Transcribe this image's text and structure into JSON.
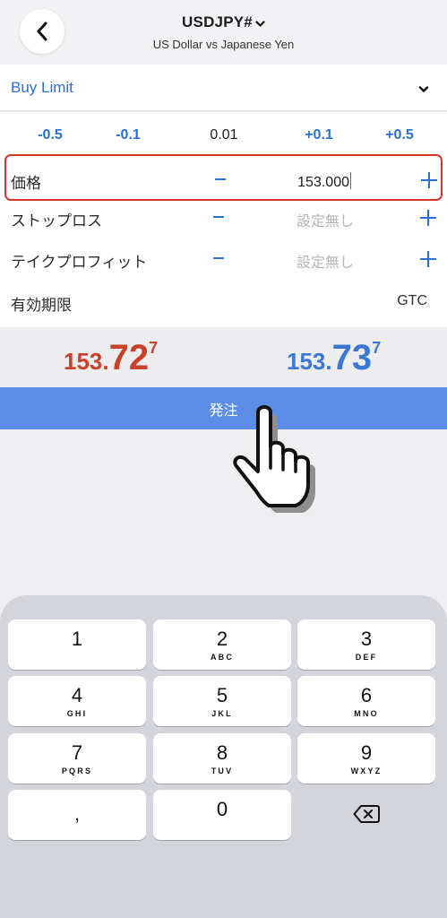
{
  "header": {
    "symbol": "USDJPY#",
    "subtitle": "US Dollar vs Japanese Yen"
  },
  "order_type": {
    "label": "Buy Limit"
  },
  "steps": [
    "-0.5",
    "-0.1",
    "0.01",
    "+0.1",
    "+0.5"
  ],
  "fields": {
    "price": {
      "label": "価格",
      "value": "153.000"
    },
    "stop_loss": {
      "label": "ストップロス",
      "value": "設定無し"
    },
    "take_profit": {
      "label": "テイクプロフィット",
      "value": "設定無し"
    },
    "expiry": {
      "label": "有効期限",
      "value": "GTC"
    }
  },
  "quotes": {
    "bid": {
      "prefix": "153.",
      "big": "72",
      "sup": "7"
    },
    "ask": {
      "prefix": "153.",
      "big": "73",
      "sup": "7"
    }
  },
  "submit": {
    "label": "発注"
  },
  "keypad": {
    "keys": [
      {
        "digit": "1",
        "letters": ""
      },
      {
        "digit": "2",
        "letters": "ABC"
      },
      {
        "digit": "3",
        "letters": "DEF"
      },
      {
        "digit": "4",
        "letters": "GHI"
      },
      {
        "digit": "5",
        "letters": "JKL"
      },
      {
        "digit": "6",
        "letters": "MNO"
      },
      {
        "digit": "7",
        "letters": "PQRS"
      },
      {
        "digit": "8",
        "letters": "TUV"
      },
      {
        "digit": "9",
        "letters": "WXYZ"
      },
      {
        "digit": ",",
        "letters": ""
      },
      {
        "digit": "0",
        "letters": ""
      }
    ]
  },
  "colors": {
    "accent": "#2a6fd6",
    "bid": "#c8412b",
    "ask": "#3b78d4",
    "submit": "#5b8de6",
    "highlight_border": "#d9342b"
  },
  "icons": [
    "back-arrow-icon",
    "chevron-down-icon",
    "minus-icon",
    "plus-icon",
    "pointing-hand-icon",
    "backspace-icon"
  ]
}
